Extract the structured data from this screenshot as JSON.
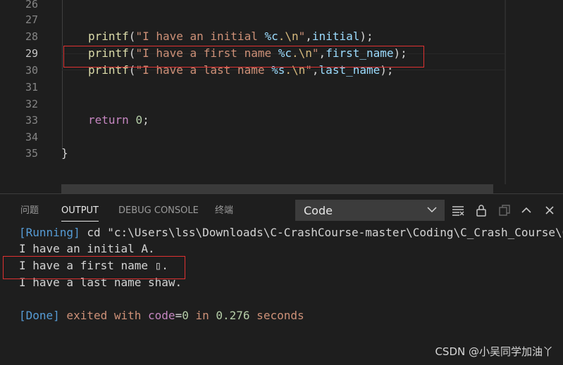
{
  "editor": {
    "lines": [
      {
        "num": "26",
        "text": ""
      },
      {
        "num": "27",
        "text": ""
      },
      {
        "num": "28",
        "fn": "printf",
        "open": "(",
        "str_a": "\"I have an initial ",
        "esc1": "%c",
        "esc2": ".\\n",
        "str_end": "\"",
        "comma": ",",
        "arg": "initial",
        "close": ");"
      },
      {
        "num": "29",
        "fn": "printf",
        "open": "(",
        "str_a": "\"I have a first name ",
        "esc1": "%c",
        "esc2": ".\\n",
        "str_end": "\"",
        "comma": ",",
        "arg": "first_name",
        "close": ");"
      },
      {
        "num": "30",
        "fn": "printf",
        "open": "(",
        "str_a": "\"I have a last name ",
        "esc1": "%s",
        "esc2": ".\\n",
        "str_end": "\"",
        "comma": ",",
        "arg": "last_name",
        "close": ");"
      },
      {
        "num": "31",
        "text": ""
      },
      {
        "num": "32",
        "text": ""
      },
      {
        "num": "33",
        "kw": "return",
        "num_val": "0",
        "semi": ";"
      },
      {
        "num": "34",
        "text": ""
      },
      {
        "num": "35",
        "brace": "}"
      }
    ]
  },
  "panel": {
    "tabs": [
      "问题",
      "OUTPUT",
      "DEBUG CONSOLE",
      "终端"
    ],
    "active_tab": "OUTPUT",
    "dropdown_value": "Code",
    "output": {
      "running_tag": "[Running]",
      "command": " cd \"c:\\Users\\lss\\Downloads\\C-CrashCourse-master\\Coding\\C_Crash_Course\\C",
      "line1": "I have an initial A.",
      "line2": "I have a first name ▯.",
      "line3": "I have a last name shaw.",
      "done_tag": "[Done]",
      "exited_with": " exited with ",
      "code_kw": "code",
      "eq": "=",
      "code_val": "0",
      "in_word": " in ",
      "duration": "0.276",
      "seconds": " seconds"
    }
  },
  "watermark": "CSDN @小吴同学加油丫"
}
